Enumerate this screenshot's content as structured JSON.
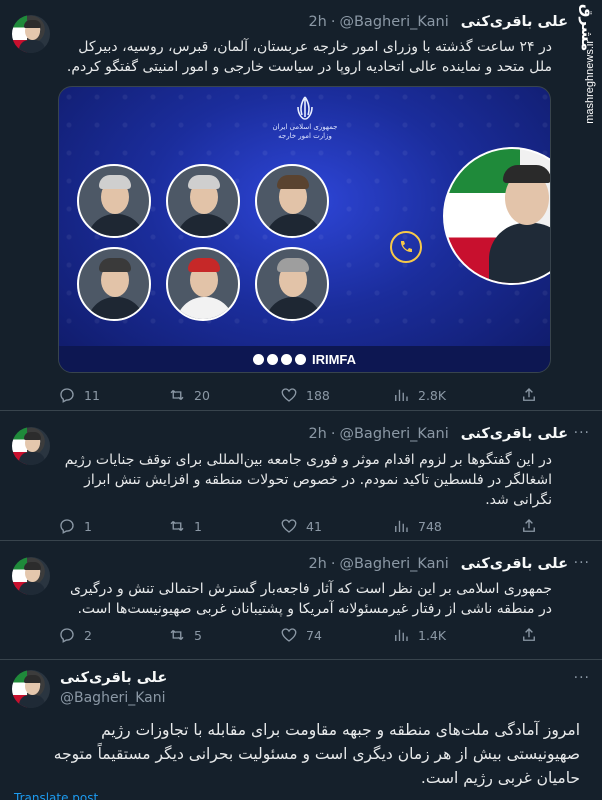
{
  "side": {
    "logo": "مشرق",
    "site": "mashreghnews.ir"
  },
  "tweets": [
    {
      "name": "علی باقری‌کنی",
      "handle": "@Bagheri_Kani",
      "dot": "·",
      "time": "2h",
      "text": "در ۲۴ ساعت گذشته با وزرای امور خارجه عربستان، آلمان، قبرس، روسیه، دبیرکل ملل متحد و نماینده عالی اتحادیه اروپا در سیاست خارجی و امور امنیتی گفتگو کردم.",
      "media": {
        "emblem_text": "جمهوری اسلامی ایران\nوزارت امور خارجه",
        "brand": "IRIMFA"
      },
      "stats": {
        "replies": "11",
        "reposts": "20",
        "likes": "188",
        "views": "2.8K"
      }
    },
    {
      "name": "علی باقری‌کنی",
      "handle": "@Bagheri_Kani",
      "dot": "·",
      "time": "2h",
      "text": "در این گفتگوها بر لزوم اقدام موثر و فوری جامعه بین‌المللی برای توقف جنایات رژیم اشغالگر در فلسطین تاکید نمودم. در خصوص تحولات منطقه و افزایش تنش ابراز نگرانی شد.",
      "stats": {
        "replies": "1",
        "reposts": "1",
        "likes": "41",
        "views": "748"
      }
    },
    {
      "name": "علی باقری‌کنی",
      "handle": "@Bagheri_Kani",
      "dot": "·",
      "time": "2h",
      "text": "جمهوری اسلامی بر این نظر است که آثار فاجعه‌بار گسترش احتمالی تنش و درگیری در منطقه ناشی از رفتار غیرمسئولانه آمریکا و پشتیبانان غربی صهیونیست‌ها است.",
      "stats": {
        "replies": "2",
        "reposts": "5",
        "likes": "74",
        "views": "1.4K"
      }
    },
    {
      "name": "علی باقری‌کنی",
      "handle": "@Bagheri_Kani",
      "text": "امروز آمادگی ملت‌های منطقه و جبهه مقاومت برای مقابله با تجاوزات رژیم صهیونیستی بیش از هر زمان دیگری است و مسئولیت بحرانی دیگر مستقیماً متوجه حامیان غربی رژیم است.",
      "translate": "Translate post"
    }
  ],
  "colors": {
    "bg": "#15202b",
    "text": "#e7e9ea",
    "muted": "#8b98a5",
    "link": "#1d9bf0",
    "border": "#38444d"
  }
}
